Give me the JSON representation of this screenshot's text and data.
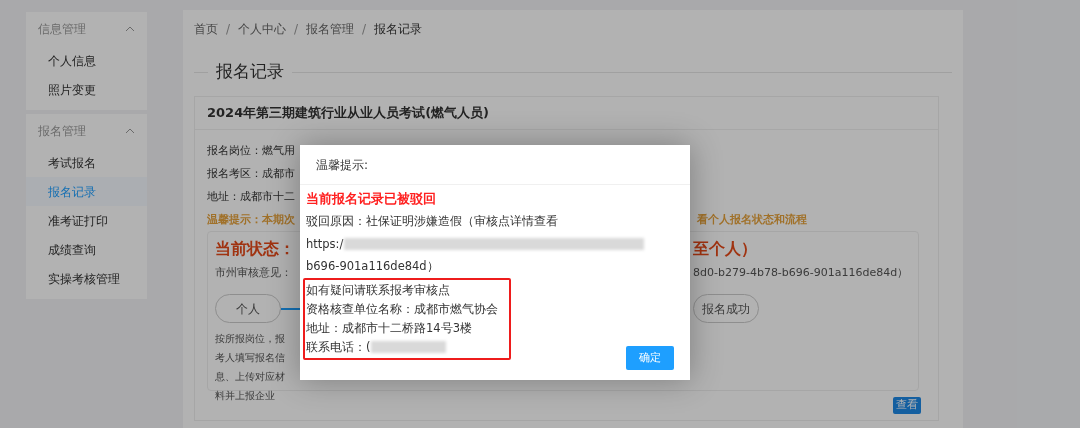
{
  "sidebar": {
    "groups": [
      {
        "title": "信息管理",
        "expanded": true,
        "items": [
          {
            "label": "个人信息",
            "selected": false
          },
          {
            "label": "照片变更",
            "selected": false
          }
        ]
      },
      {
        "title": "报名管理",
        "expanded": true,
        "items": [
          {
            "label": "考试报名",
            "selected": false
          },
          {
            "label": "报名记录",
            "selected": true
          },
          {
            "label": "准考证打印",
            "selected": false
          },
          {
            "label": "成绩查询",
            "selected": false
          },
          {
            "label": "实操考核管理",
            "selected": false
          }
        ]
      }
    ]
  },
  "breadcrumb": [
    "首页",
    "个人中心",
    "报名管理",
    "报名记录"
  ],
  "breadcrumb_separator": "/",
  "section_title": "报名记录",
  "record": {
    "title": "2024年第三期建筑行业从业人员考试(燃气人员)",
    "left_lines": [
      "报名岗位：燃气用",
      "报名考区：成都市",
      "地址：成都市十二"
    ],
    "tip_left": "温馨提示：本期次",
    "tip_right": "看个人报名状态和流程",
    "status_left": "当前状态：",
    "status_right": "至个人）",
    "opinion_left": "市州审核意见：",
    "opinion_right": "8d0-b279-4b78-b696-901a116de84d）",
    "steps": [
      {
        "label": "个人",
        "description": "按所报岗位，报考人填写报名信息、上传对应材料并上报企业"
      },
      {
        "label": "报名成功"
      }
    ],
    "view_button": "查看"
  },
  "dialog": {
    "title": "温馨提示:",
    "heading": "当前报名记录已被驳回",
    "reason": "驳回原因：社保证明涉嫌造假（审核点详情查看",
    "url_start": "https:/",
    "url_end": "b696-901a116de84d）",
    "highlight_lines": [
      "如有疑问请联系报考审核点",
      "资格核查单位名称：成都市燃气协会",
      "地址：成都市十二桥路14号3楼"
    ],
    "phone_label": "联系电话：(",
    "confirm": "确定"
  }
}
